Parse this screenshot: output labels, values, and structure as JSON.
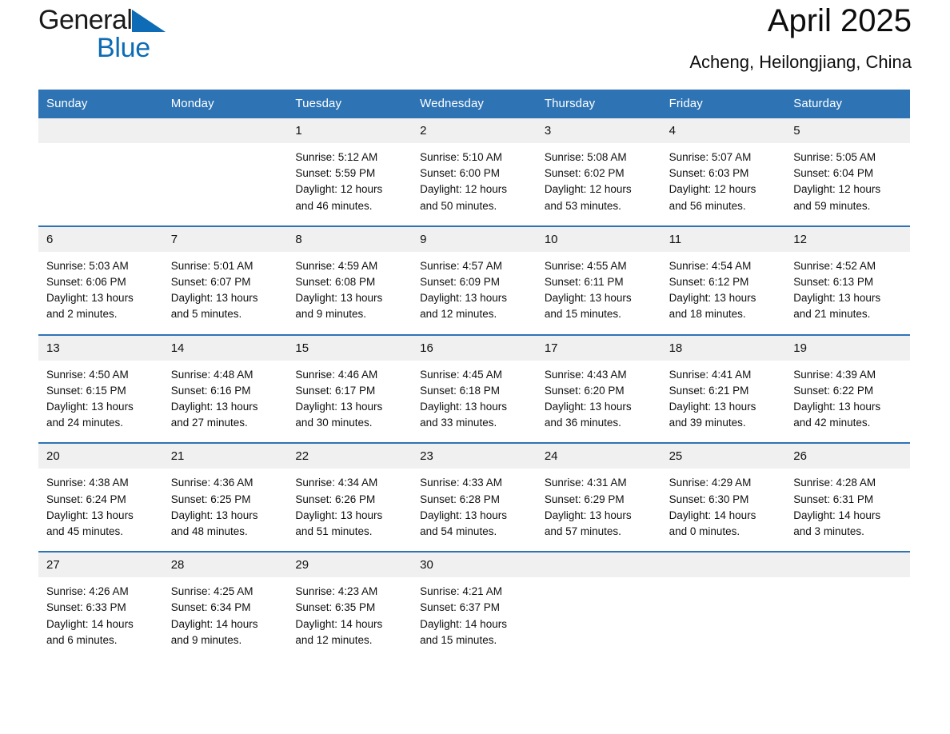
{
  "brand": {
    "word1": "General",
    "word2": "Blue",
    "triangle_color": "#0d6cb5",
    "icon": "triangle-logo-icon"
  },
  "header": {
    "title": "April 2025",
    "subtitle": "Acheng, Heilongjiang, China"
  },
  "theme": {
    "header_blue": "#2e74b5",
    "row_gray": "#f0f0f0",
    "text": "#101010"
  },
  "weekdays": [
    "Sunday",
    "Monday",
    "Tuesday",
    "Wednesday",
    "Thursday",
    "Friday",
    "Saturday"
  ],
  "weeks": [
    [
      {
        "day": "",
        "lines": []
      },
      {
        "day": "",
        "lines": []
      },
      {
        "day": "1",
        "lines": [
          "Sunrise: 5:12 AM",
          "Sunset: 5:59 PM",
          "Daylight: 12 hours",
          "and 46 minutes."
        ]
      },
      {
        "day": "2",
        "lines": [
          "Sunrise: 5:10 AM",
          "Sunset: 6:00 PM",
          "Daylight: 12 hours",
          "and 50 minutes."
        ]
      },
      {
        "day": "3",
        "lines": [
          "Sunrise: 5:08 AM",
          "Sunset: 6:02 PM",
          "Daylight: 12 hours",
          "and 53 minutes."
        ]
      },
      {
        "day": "4",
        "lines": [
          "Sunrise: 5:07 AM",
          "Sunset: 6:03 PM",
          "Daylight: 12 hours",
          "and 56 minutes."
        ]
      },
      {
        "day": "5",
        "lines": [
          "Sunrise: 5:05 AM",
          "Sunset: 6:04 PM",
          "Daylight: 12 hours",
          "and 59 minutes."
        ]
      }
    ],
    [
      {
        "day": "6",
        "lines": [
          "Sunrise: 5:03 AM",
          "Sunset: 6:06 PM",
          "Daylight: 13 hours",
          "and 2 minutes."
        ]
      },
      {
        "day": "7",
        "lines": [
          "Sunrise: 5:01 AM",
          "Sunset: 6:07 PM",
          "Daylight: 13 hours",
          "and 5 minutes."
        ]
      },
      {
        "day": "8",
        "lines": [
          "Sunrise: 4:59 AM",
          "Sunset: 6:08 PM",
          "Daylight: 13 hours",
          "and 9 minutes."
        ]
      },
      {
        "day": "9",
        "lines": [
          "Sunrise: 4:57 AM",
          "Sunset: 6:09 PM",
          "Daylight: 13 hours",
          "and 12 minutes."
        ]
      },
      {
        "day": "10",
        "lines": [
          "Sunrise: 4:55 AM",
          "Sunset: 6:11 PM",
          "Daylight: 13 hours",
          "and 15 minutes."
        ]
      },
      {
        "day": "11",
        "lines": [
          "Sunrise: 4:54 AM",
          "Sunset: 6:12 PM",
          "Daylight: 13 hours",
          "and 18 minutes."
        ]
      },
      {
        "day": "12",
        "lines": [
          "Sunrise: 4:52 AM",
          "Sunset: 6:13 PM",
          "Daylight: 13 hours",
          "and 21 minutes."
        ]
      }
    ],
    [
      {
        "day": "13",
        "lines": [
          "Sunrise: 4:50 AM",
          "Sunset: 6:15 PM",
          "Daylight: 13 hours",
          "and 24 minutes."
        ]
      },
      {
        "day": "14",
        "lines": [
          "Sunrise: 4:48 AM",
          "Sunset: 6:16 PM",
          "Daylight: 13 hours",
          "and 27 minutes."
        ]
      },
      {
        "day": "15",
        "lines": [
          "Sunrise: 4:46 AM",
          "Sunset: 6:17 PM",
          "Daylight: 13 hours",
          "and 30 minutes."
        ]
      },
      {
        "day": "16",
        "lines": [
          "Sunrise: 4:45 AM",
          "Sunset: 6:18 PM",
          "Daylight: 13 hours",
          "and 33 minutes."
        ]
      },
      {
        "day": "17",
        "lines": [
          "Sunrise: 4:43 AM",
          "Sunset: 6:20 PM",
          "Daylight: 13 hours",
          "and 36 minutes."
        ]
      },
      {
        "day": "18",
        "lines": [
          "Sunrise: 4:41 AM",
          "Sunset: 6:21 PM",
          "Daylight: 13 hours",
          "and 39 minutes."
        ]
      },
      {
        "day": "19",
        "lines": [
          "Sunrise: 4:39 AM",
          "Sunset: 6:22 PM",
          "Daylight: 13 hours",
          "and 42 minutes."
        ]
      }
    ],
    [
      {
        "day": "20",
        "lines": [
          "Sunrise: 4:38 AM",
          "Sunset: 6:24 PM",
          "Daylight: 13 hours",
          "and 45 minutes."
        ]
      },
      {
        "day": "21",
        "lines": [
          "Sunrise: 4:36 AM",
          "Sunset: 6:25 PM",
          "Daylight: 13 hours",
          "and 48 minutes."
        ]
      },
      {
        "day": "22",
        "lines": [
          "Sunrise: 4:34 AM",
          "Sunset: 6:26 PM",
          "Daylight: 13 hours",
          "and 51 minutes."
        ]
      },
      {
        "day": "23",
        "lines": [
          "Sunrise: 4:33 AM",
          "Sunset: 6:28 PM",
          "Daylight: 13 hours",
          "and 54 minutes."
        ]
      },
      {
        "day": "24",
        "lines": [
          "Sunrise: 4:31 AM",
          "Sunset: 6:29 PM",
          "Daylight: 13 hours",
          "and 57 minutes."
        ]
      },
      {
        "day": "25",
        "lines": [
          "Sunrise: 4:29 AM",
          "Sunset: 6:30 PM",
          "Daylight: 14 hours",
          "and 0 minutes."
        ]
      },
      {
        "day": "26",
        "lines": [
          "Sunrise: 4:28 AM",
          "Sunset: 6:31 PM",
          "Daylight: 14 hours",
          "and 3 minutes."
        ]
      }
    ],
    [
      {
        "day": "27",
        "lines": [
          "Sunrise: 4:26 AM",
          "Sunset: 6:33 PM",
          "Daylight: 14 hours",
          "and 6 minutes."
        ]
      },
      {
        "day": "28",
        "lines": [
          "Sunrise: 4:25 AM",
          "Sunset: 6:34 PM",
          "Daylight: 14 hours",
          "and 9 minutes."
        ]
      },
      {
        "day": "29",
        "lines": [
          "Sunrise: 4:23 AM",
          "Sunset: 6:35 PM",
          "Daylight: 14 hours",
          "and 12 minutes."
        ]
      },
      {
        "day": "30",
        "lines": [
          "Sunrise: 4:21 AM",
          "Sunset: 6:37 PM",
          "Daylight: 14 hours",
          "and 15 minutes."
        ]
      },
      {
        "day": "",
        "lines": []
      },
      {
        "day": "",
        "lines": []
      },
      {
        "day": "",
        "lines": []
      }
    ]
  ]
}
